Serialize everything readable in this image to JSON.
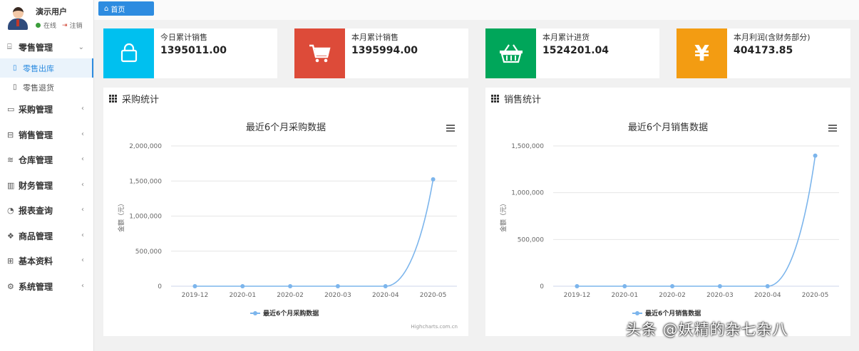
{
  "user": {
    "name": "演示用户",
    "status": "在线",
    "logout": "注销"
  },
  "sidebar": {
    "items": [
      {
        "label": "零售管理",
        "icon": "gift-icon",
        "open": true
      },
      {
        "label": "采购管理",
        "icon": "monitor-icon"
      },
      {
        "label": "销售管理",
        "icon": "briefcase-icon"
      },
      {
        "label": "仓库管理",
        "icon": "layers-icon"
      },
      {
        "label": "财务管理",
        "icon": "map-icon"
      },
      {
        "label": "报表查询",
        "icon": "pie-icon"
      },
      {
        "label": "商品管理",
        "icon": "box-icon"
      },
      {
        "label": "基本资料",
        "icon": "grid-icon"
      },
      {
        "label": "系统管理",
        "icon": "gear-icon"
      }
    ],
    "subitems": [
      {
        "label": "零售出库",
        "active": true
      },
      {
        "label": "零售退货",
        "active": false
      }
    ]
  },
  "tabs": {
    "home": "首页"
  },
  "stats": [
    {
      "label": "今日累计销售",
      "value": "1395011.00",
      "color": "#00c0ef",
      "icon": "bag-icon"
    },
    {
      "label": "本月累计销售",
      "value": "1395994.00",
      "color": "#dd4b39",
      "icon": "cart-icon"
    },
    {
      "label": "本月累计进货",
      "value": "1524201.04",
      "color": "#00a65a",
      "icon": "basket-icon"
    },
    {
      "label": "本月利润(含财务部分)",
      "value": "404173.85",
      "color": "#f39c12",
      "icon": "yen-icon"
    }
  ],
  "panels": [
    {
      "title": "采购统计"
    },
    {
      "title": "销售统计"
    }
  ],
  "chart_data": [
    {
      "type": "line",
      "title": "最近6个月采购数据",
      "ylabel": "金额（元）",
      "xlabel": "",
      "categories": [
        "2019-12",
        "2020-01",
        "2020-02",
        "2020-03",
        "2020-04",
        "2020-05"
      ],
      "series": [
        {
          "name": "最近6个月采购数据",
          "values": [
            0,
            0,
            0,
            0,
            0,
            1524201
          ],
          "color": "#7cb5ec"
        }
      ],
      "ylim": [
        0,
        2000000
      ],
      "yticks": [
        "0",
        "500,000",
        "1,000,000",
        "1,500,000",
        "2,000,000"
      ],
      "ytick_values": [
        0,
        500000,
        1000000,
        1500000,
        2000000
      ],
      "credits": "Highcharts.com.cn",
      "grid": true,
      "legend": "bottom-center"
    },
    {
      "type": "line",
      "title": "最近6个月销售数据",
      "ylabel": "金额（元）",
      "xlabel": "",
      "categories": [
        "2019-12",
        "2020-01",
        "2020-02",
        "2020-03",
        "2020-04",
        "2020-05"
      ],
      "series": [
        {
          "name": "最近6个月销售数据",
          "values": [
            0,
            0,
            0,
            0,
            0,
            1395994
          ],
          "color": "#7cb5ec"
        }
      ],
      "ylim": [
        0,
        1500000
      ],
      "yticks": [
        "0",
        "500,000",
        "1,000,000",
        "1,500,000"
      ],
      "ytick_values": [
        0,
        500000,
        1000000,
        1500000
      ],
      "credits": "",
      "grid": true,
      "legend": "bottom-center"
    }
  ],
  "watermark": "头条 @妖精的杂七杂八"
}
